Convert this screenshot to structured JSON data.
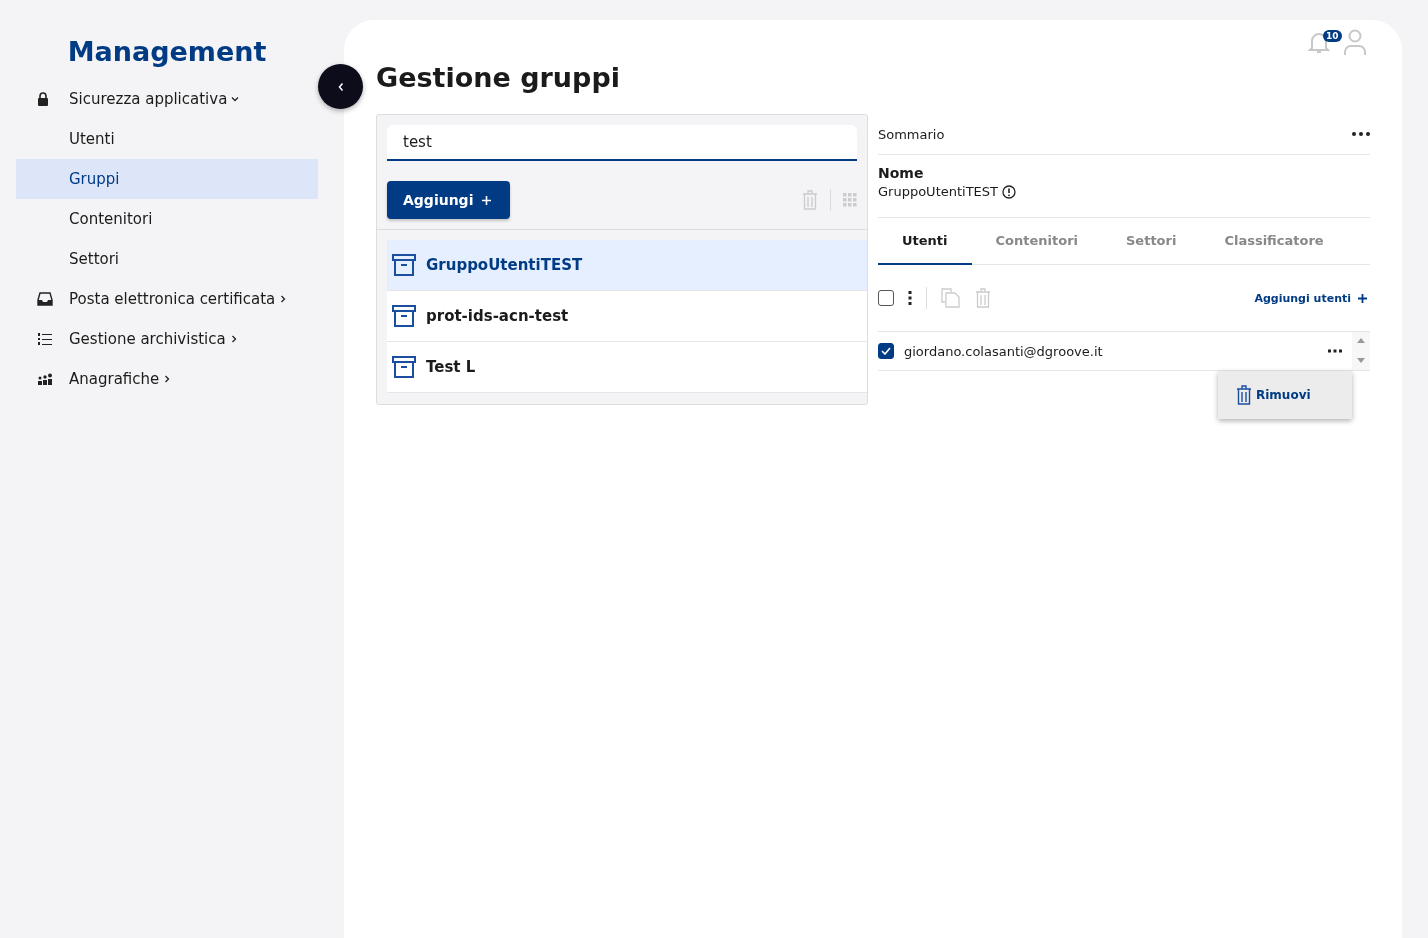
{
  "brand": "Management",
  "nav": [
    {
      "label": "Sicurezza applicativa",
      "kind": "lock",
      "expanded": true,
      "children": [
        {
          "label": "Utenti",
          "selected": false
        },
        {
          "label": "Gruppi",
          "selected": true
        },
        {
          "label": "Contenitori",
          "selected": false
        },
        {
          "label": "Settori",
          "selected": false
        }
      ]
    },
    {
      "label": "Posta elettronica certificata",
      "kind": "inbox",
      "expanded": false
    },
    {
      "label": "Gestione archivistica",
      "kind": "list",
      "expanded": false
    },
    {
      "label": "Anagrafiche",
      "kind": "people",
      "expanded": false
    }
  ],
  "header": {
    "notifications": "10"
  },
  "title": "Gestione gruppi",
  "search": {
    "value": "test"
  },
  "add_button": "Aggiungi",
  "groups": [
    {
      "name": "GruppoUtentiTEST",
      "selected": true
    },
    {
      "name": "prot-ids-acn-test",
      "selected": false
    },
    {
      "name": "Test L",
      "selected": false
    }
  ],
  "detail": {
    "section": "Sommario",
    "name_label": "Nome",
    "name_value": "GruppoUtentiTEST",
    "tabs": [
      {
        "label": "Utenti",
        "selected": true
      },
      {
        "label": "Contenitori",
        "selected": false
      },
      {
        "label": "Settori",
        "selected": false
      },
      {
        "label": "Classificatore",
        "selected": false
      }
    ],
    "select_all": {
      "checked": false
    },
    "add_users": "Aggiungi utenti",
    "users": [
      {
        "email": "giordano.colasanti@dgroove.it",
        "checked": true
      }
    ],
    "menu": [
      {
        "label": "Rimuovi"
      }
    ]
  }
}
